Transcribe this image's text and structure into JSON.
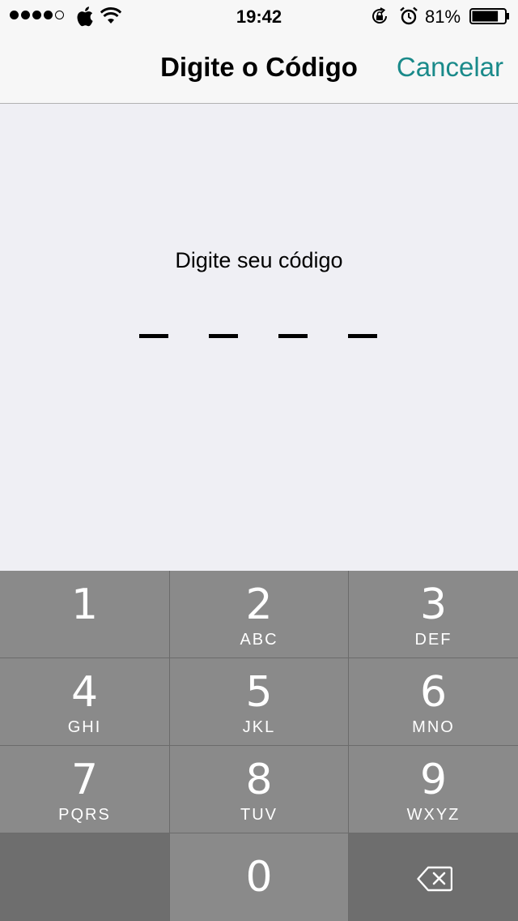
{
  "status_bar": {
    "signal_dots_filled": 4,
    "signal_dots_total": 5,
    "time": "19:42",
    "battery_percent": "81%",
    "battery_level": 0.81,
    "icons": [
      "apple-icon",
      "wifi-icon",
      "rotation-lock-icon",
      "alarm-icon",
      "battery-icon"
    ]
  },
  "nav": {
    "title": "Digite o Código",
    "cancel_label": "Cancelar"
  },
  "content": {
    "prompt": "Digite seu código",
    "code_length": 4
  },
  "keypad": {
    "keys": [
      {
        "num": "1",
        "letters": ""
      },
      {
        "num": "2",
        "letters": "ABC"
      },
      {
        "num": "3",
        "letters": "DEF"
      },
      {
        "num": "4",
        "letters": "GHI"
      },
      {
        "num": "5",
        "letters": "JKL"
      },
      {
        "num": "6",
        "letters": "MNO"
      },
      {
        "num": "7",
        "letters": "PQRS"
      },
      {
        "num": "8",
        "letters": "TUV"
      },
      {
        "num": "9",
        "letters": "WXYZ"
      }
    ],
    "zero": "0",
    "delete_icon": "backspace-icon"
  },
  "colors": {
    "accent": "#1a8a8a",
    "background": "#efeff4",
    "key_light": "#8a8a8a",
    "key_dark": "#6e6e6e",
    "key_divider": "#6b6b6b"
  }
}
